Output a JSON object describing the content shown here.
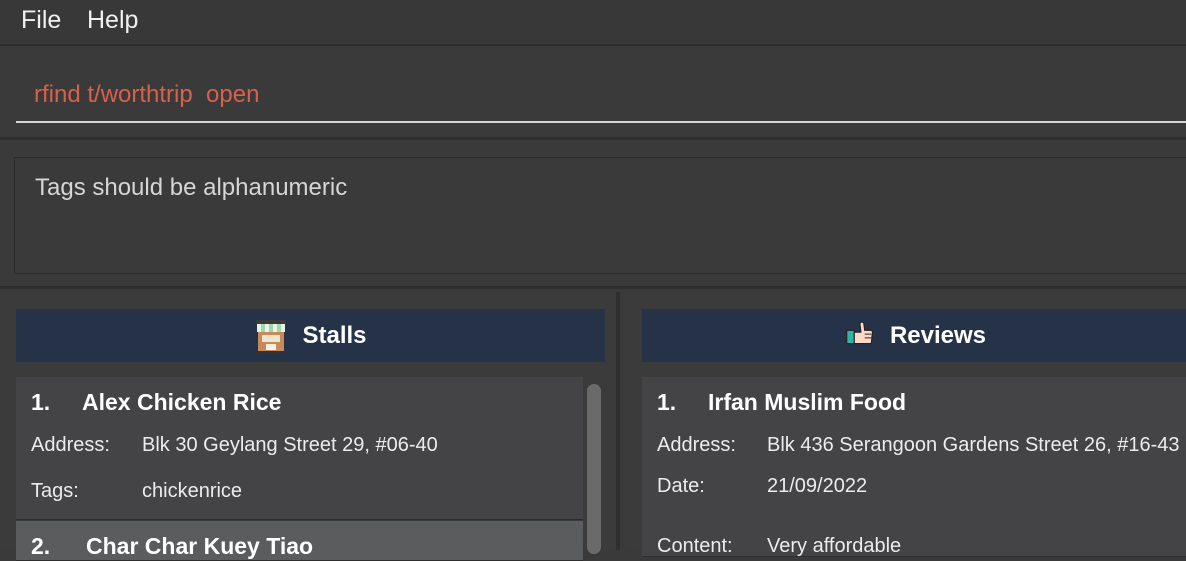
{
  "menu": {
    "file": "File",
    "help": "Help"
  },
  "command": {
    "value": "rfind t/worthtrip  open"
  },
  "result": {
    "message": "Tags should be alphanumeric"
  },
  "stalls": {
    "title": "Stalls",
    "icon": "stall-icon",
    "items": [
      {
        "index": "1.",
        "name": "Alex Chicken Rice",
        "address_label": "Address:",
        "address": "Blk 30 Geylang Street 29, #06-40",
        "tags_label": "Tags:",
        "tags": "chickenrice"
      },
      {
        "index": "2.",
        "name": "Char Char Kuey Tiao"
      }
    ]
  },
  "reviews": {
    "title": "Reviews",
    "icon": "thumbs-up-icon",
    "items": [
      {
        "index": "1.",
        "name": "Irfan Muslim Food",
        "address_label": "Address:",
        "address": "Blk 436 Serangoon Gardens Street 26, #16-43",
        "date_label": "Date:",
        "date": "21/09/2022",
        "content_label": "Content:",
        "content": "Very affordable"
      }
    ]
  },
  "colors": {
    "header_bg": "#253248",
    "command_text": "#d9604a",
    "selected_card": "#5b5c5e"
  }
}
